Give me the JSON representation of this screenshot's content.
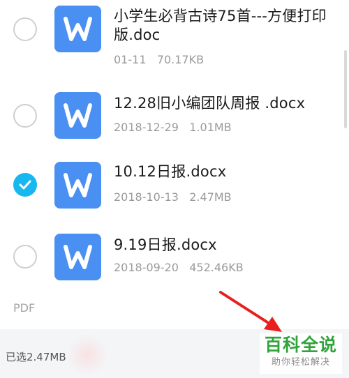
{
  "files": [
    {
      "name": "小学生必背古诗75首---方便打印版.doc",
      "date": "01-11",
      "size": "70.17KB",
      "checked": false
    },
    {
      "name": "12.28旧小编团队周报 .docx",
      "date": "2018-12-29",
      "size": "1.01MB",
      "checked": false
    },
    {
      "name": "10.12日报.docx",
      "date": "2018-10-13",
      "size": "2.47MB",
      "checked": true
    },
    {
      "name": "9.19日报.docx",
      "date": "2018-09-20",
      "size": "452.46KB",
      "checked": false
    }
  ],
  "section_label": "PDF",
  "bottom_bar": {
    "selected_text": "已选2.47MB"
  },
  "watermark": {
    "main": "百科全说",
    "sub": "助你轻松解决"
  },
  "colors": {
    "accent": "#17b8f0",
    "word_icon": "#4a8ff2",
    "arrow": "#e8201f",
    "watermark": "#2fa43a"
  },
  "icons": {
    "file_icon": "word-doc-icon",
    "check_icon": "checkmark-icon"
  }
}
